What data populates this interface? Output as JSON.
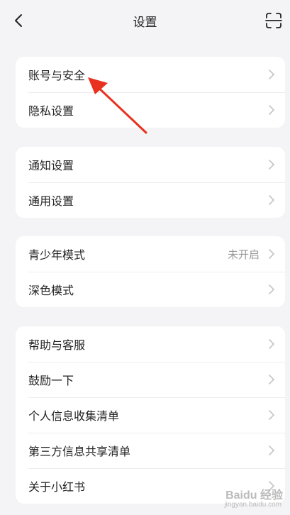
{
  "header": {
    "title": "设置",
    "back_icon": "chevron-left-icon",
    "scan_icon": "scan-icon"
  },
  "groups": [
    {
      "items": [
        {
          "label": "账号与安全"
        },
        {
          "label": "隐私设置"
        }
      ]
    },
    {
      "items": [
        {
          "label": "通知设置"
        },
        {
          "label": "通用设置"
        }
      ]
    },
    {
      "items": [
        {
          "label": "青少年模式",
          "value": "未开启"
        },
        {
          "label": "深色模式"
        }
      ]
    },
    {
      "items": [
        {
          "label": "帮助与客服"
        },
        {
          "label": "鼓励一下"
        },
        {
          "label": "个人信息收集清单"
        },
        {
          "label": "第三方信息共享清单"
        },
        {
          "label": "关于小红书"
        }
      ]
    }
  ],
  "annotation": {
    "color": "#e8321f"
  },
  "watermark": {
    "line1": "Baidu 经验",
    "line2": "jingyan.baidu.com"
  }
}
